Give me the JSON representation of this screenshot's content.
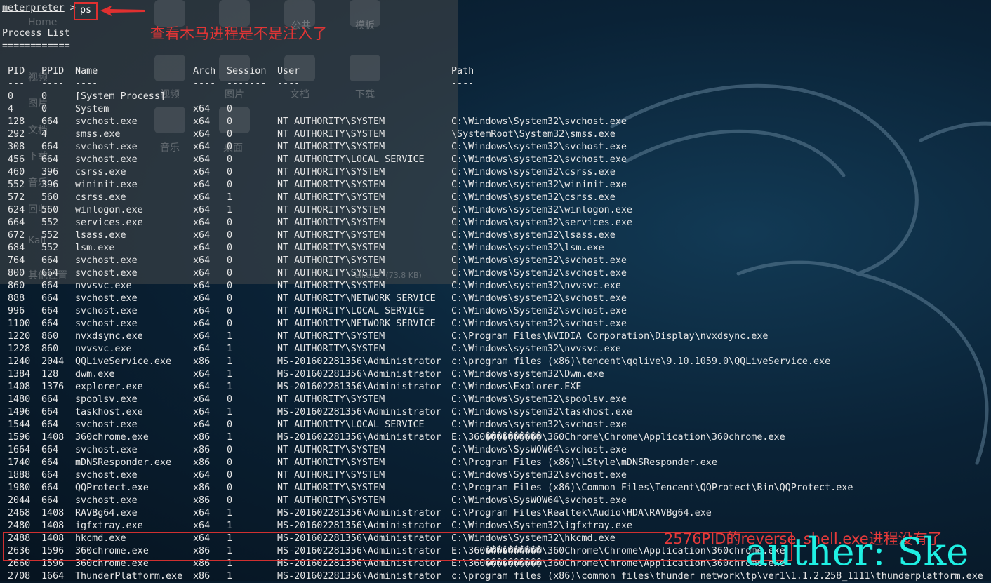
{
  "terminal": {
    "prompt": "meterpreter",
    "prompt_sep": " > ",
    "command": "ps",
    "title": "Process List",
    "underline": "============",
    "headers": {
      "pid": "PID",
      "ppid": "PPID",
      "name": "Name",
      "arch": "Arch",
      "session": "Session",
      "user": "User",
      "path": "Path"
    },
    "dashes": {
      "pid": "---",
      "ppid": "----",
      "name": "----",
      "arch": "----",
      "session": "-------",
      "user": "----",
      "path": "----"
    },
    "rows": [
      [
        "0",
        "0",
        "[System Process]",
        "",
        "",
        "",
        ""
      ],
      [
        "4",
        "0",
        "System",
        "x64",
        "0",
        "",
        ""
      ],
      [
        "128",
        "664",
        "svchost.exe",
        "x64",
        "0",
        "NT AUTHORITY\\SYSTEM",
        "C:\\Windows\\System32\\svchost.exe"
      ],
      [
        "292",
        "4",
        "smss.exe",
        "x64",
        "0",
        "NT AUTHORITY\\SYSTEM",
        "\\SystemRoot\\System32\\smss.exe"
      ],
      [
        "308",
        "664",
        "svchost.exe",
        "x64",
        "0",
        "NT AUTHORITY\\SYSTEM",
        "C:\\Windows\\system32\\svchost.exe"
      ],
      [
        "456",
        "664",
        "svchost.exe",
        "x64",
        "0",
        "NT AUTHORITY\\LOCAL SERVICE",
        "C:\\Windows\\system32\\svchost.exe"
      ],
      [
        "460",
        "396",
        "csrss.exe",
        "x64",
        "0",
        "NT AUTHORITY\\SYSTEM",
        "C:\\Windows\\system32\\csrss.exe"
      ],
      [
        "552",
        "396",
        "wininit.exe",
        "x64",
        "0",
        "NT AUTHORITY\\SYSTEM",
        "C:\\Windows\\system32\\wininit.exe"
      ],
      [
        "572",
        "560",
        "csrss.exe",
        "x64",
        "1",
        "NT AUTHORITY\\SYSTEM",
        "C:\\Windows\\system32\\csrss.exe"
      ],
      [
        "624",
        "560",
        "winlogon.exe",
        "x64",
        "1",
        "NT AUTHORITY\\SYSTEM",
        "C:\\Windows\\system32\\winlogon.exe"
      ],
      [
        "664",
        "552",
        "services.exe",
        "x64",
        "0",
        "NT AUTHORITY\\SYSTEM",
        "C:\\Windows\\system32\\services.exe"
      ],
      [
        "672",
        "552",
        "lsass.exe",
        "x64",
        "0",
        "NT AUTHORITY\\SYSTEM",
        "C:\\Windows\\system32\\lsass.exe"
      ],
      [
        "684",
        "552",
        "lsm.exe",
        "x64",
        "0",
        "NT AUTHORITY\\SYSTEM",
        "C:\\Windows\\system32\\lsm.exe"
      ],
      [
        "764",
        "664",
        "svchost.exe",
        "x64",
        "0",
        "NT AUTHORITY\\SYSTEM",
        "C:\\Windows\\system32\\svchost.exe"
      ],
      [
        "800",
        "664",
        "svchost.exe",
        "x64",
        "0",
        "NT AUTHORITY\\SYSTEM",
        "C:\\Windows\\System32\\svchost.exe"
      ],
      [
        "860",
        "664",
        "nvvsvc.exe",
        "x64",
        "0",
        "NT AUTHORITY\\SYSTEM",
        "C:\\Windows\\system32\\nvvsvc.exe"
      ],
      [
        "888",
        "664",
        "svchost.exe",
        "x64",
        "0",
        "NT AUTHORITY\\NETWORK SERVICE",
        "C:\\Windows\\system32\\svchost.exe"
      ],
      [
        "996",
        "664",
        "svchost.exe",
        "x64",
        "0",
        "NT AUTHORITY\\LOCAL SERVICE",
        "C:\\Windows\\System32\\svchost.exe"
      ],
      [
        "1100",
        "664",
        "svchost.exe",
        "x64",
        "0",
        "NT AUTHORITY\\NETWORK SERVICE",
        "C:\\Windows\\system32\\svchost.exe"
      ],
      [
        "1220",
        "860",
        "nvxdsync.exe",
        "x64",
        "1",
        "NT AUTHORITY\\SYSTEM",
        "C:\\Program Files\\NVIDIA Corporation\\Display\\nvxdsync.exe"
      ],
      [
        "1228",
        "860",
        "nvvsvc.exe",
        "x64",
        "1",
        "NT AUTHORITY\\SYSTEM",
        "C:\\Windows\\system32\\nvvsvc.exe"
      ],
      [
        "1240",
        "2044",
        "QQLiveService.exe",
        "x86",
        "1",
        "MS-201602281356\\Administrator",
        "c:\\program files (x86)\\tencent\\qqlive\\9.10.1059.0\\QQLiveService.exe"
      ],
      [
        "1384",
        "128",
        "dwm.exe",
        "x64",
        "1",
        "MS-201602281356\\Administrator",
        "C:\\Windows\\system32\\Dwm.exe"
      ],
      [
        "1408",
        "1376",
        "explorer.exe",
        "x64",
        "1",
        "MS-201602281356\\Administrator",
        "C:\\Windows\\Explorer.EXE"
      ],
      [
        "1480",
        "664",
        "spoolsv.exe",
        "x64",
        "0",
        "NT AUTHORITY\\SYSTEM",
        "C:\\Windows\\System32\\spoolsv.exe"
      ],
      [
        "1496",
        "664",
        "taskhost.exe",
        "x64",
        "1",
        "MS-201602281356\\Administrator",
        "C:\\Windows\\system32\\taskhost.exe"
      ],
      [
        "1544",
        "664",
        "svchost.exe",
        "x64",
        "0",
        "NT AUTHORITY\\LOCAL SERVICE",
        "C:\\Windows\\system32\\svchost.exe"
      ],
      [
        "1596",
        "1408",
        "360chrome.exe",
        "x86",
        "1",
        "MS-201602281356\\Administrator",
        "E:\\360����������\\360Chrome\\Chrome\\Application\\360chrome.exe"
      ],
      [
        "1664",
        "664",
        "svchost.exe",
        "x86",
        "0",
        "NT AUTHORITY\\SYSTEM",
        "C:\\Windows\\SysWOW64\\svchost.exe"
      ],
      [
        "1740",
        "664",
        "mDNSResponder.exe",
        "x86",
        "0",
        "NT AUTHORITY\\SYSTEM",
        "C:\\Program Files (x86)\\LStyle\\mDNSResponder.exe"
      ],
      [
        "1888",
        "664",
        "svchost.exe",
        "x64",
        "0",
        "NT AUTHORITY\\SYSTEM",
        "C:\\Windows\\System32\\svchost.exe"
      ],
      [
        "1980",
        "664",
        "QQProtect.exe",
        "x86",
        "0",
        "NT AUTHORITY\\SYSTEM",
        "C:\\Program Files (x86)\\Common Files\\Tencent\\QQProtect\\Bin\\QQProtect.exe"
      ],
      [
        "2044",
        "664",
        "svchost.exe",
        "x86",
        "0",
        "NT AUTHORITY\\SYSTEM",
        "C:\\Windows\\SysWOW64\\svchost.exe"
      ],
      [
        "2468",
        "1408",
        "RAVBg64.exe",
        "x64",
        "1",
        "MS-201602281356\\Administrator",
        "C:\\Program Files\\Realtek\\Audio\\HDA\\RAVBg64.exe"
      ],
      [
        "2480",
        "1408",
        "igfxtray.exe",
        "x64",
        "1",
        "MS-201602281356\\Administrator",
        "C:\\Windows\\System32\\igfxtray.exe"
      ],
      [
        "2488",
        "1408",
        "hkcmd.exe",
        "x64",
        "1",
        "MS-201602281356\\Administrator",
        "C:\\Windows\\System32\\hkcmd.exe"
      ],
      [
        "2636",
        "1596",
        "360chrome.exe",
        "x86",
        "1",
        "MS-201602281356\\Administrator",
        "E:\\360����������\\360Chrome\\Chrome\\Application\\360chrome.exe"
      ],
      [
        "2660",
        "1596",
        "360chrome.exe",
        "x86",
        "1",
        "MS-201602281356\\Administrator",
        "E:\\360����������\\360Chrome\\Chrome\\Application\\360chrome.exe"
      ],
      [
        "2708",
        "1664",
        "ThunderPlatform.exe",
        "x86",
        "1",
        "MS-201602281356\\Administrator",
        "c:\\program files (x86)\\common files\\thunder network\\tp\\ver1\\1.1.2.258_1111\\thunderplatform.exe"
      ]
    ]
  },
  "annotations": {
    "top_note": "查看木马进程是不是注入了",
    "bottom_note": "2576PID的reverse_shell.exe进程没有了",
    "watermark": "auther: Ske"
  },
  "background_window": {
    "labels": [
      "Home",
      "模板",
      "公共",
      "视频",
      "图片",
      "文档",
      "下载",
      "音乐",
      "桌面",
      "桌面",
      "视频",
      "图片",
      "文档",
      "下载",
      "音乐",
      "回收",
      "Kali",
      "其他位置"
    ],
    "status_text": "ell.exe\" (73.8 KB)"
  },
  "colors": {
    "annotation": "#e03535",
    "watermark": "#1ff0e3",
    "text": "#e6e6e6"
  }
}
